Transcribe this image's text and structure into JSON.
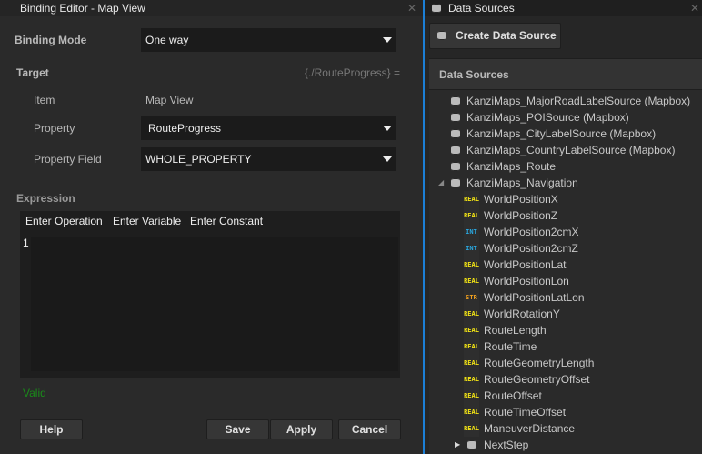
{
  "editor": {
    "title": "Binding Editor - Map View",
    "binding_mode_label": "Binding Mode",
    "binding_mode_value": "One way",
    "target_label": "Target",
    "target_expr": "{./RouteProgress} =",
    "item_label": "Item",
    "item_value": "Map View",
    "property_label": "Property",
    "property_value": "RouteProgress",
    "property_field_label": "Property Field",
    "property_field_value": "WHOLE_PROPERTY",
    "expression_label": "Expression",
    "toolbar": [
      "Enter Operation",
      "Enter Variable",
      "Enter Constant"
    ],
    "line_number": "1",
    "status": "Valid",
    "help": "Help",
    "save": "Save",
    "apply": "Apply",
    "cancel": "Cancel",
    "status_color": "#1a8a1a"
  },
  "datasources": {
    "title": "Data Sources",
    "create_button": "Create Data Source",
    "header": "Data Sources",
    "sources": [
      "KanziMaps_MajorRoadLabelSource (Mapbox)",
      "KanziMaps_POISource (Mapbox)",
      "KanziMaps_CityLabelSource (Mapbox)",
      "KanziMaps_CountryLabelSource (Mapbox)",
      "KanziMaps_Route",
      "KanziMaps_Navigation"
    ],
    "fields": [
      {
        "type": "REAL",
        "name": "WorldPositionX"
      },
      {
        "type": "REAL",
        "name": "WorldPositionZ"
      },
      {
        "type": "INT",
        "name": "WorldPosition2cmX"
      },
      {
        "type": "INT",
        "name": "WorldPosition2cmZ"
      },
      {
        "type": "REAL",
        "name": "WorldPositionLat"
      },
      {
        "type": "REAL",
        "name": "WorldPositionLon"
      },
      {
        "type": "STR",
        "name": "WorldPositionLatLon"
      },
      {
        "type": "REAL",
        "name": "WorldRotationY"
      },
      {
        "type": "REAL",
        "name": "RouteLength"
      },
      {
        "type": "REAL",
        "name": "RouteTime"
      },
      {
        "type": "REAL",
        "name": "RouteGeometryLength"
      },
      {
        "type": "REAL",
        "name": "RouteGeometryOffset"
      },
      {
        "type": "REAL",
        "name": "RouteOffset"
      },
      {
        "type": "REAL",
        "name": "RouteTimeOffset"
      },
      {
        "type": "REAL",
        "name": "ManeuverDistance"
      }
    ],
    "child_source": "NextStep",
    "type_colors": {
      "REAL": "#f5e614",
      "INT": "#2aa8e0",
      "STR": "#f0a020"
    }
  }
}
